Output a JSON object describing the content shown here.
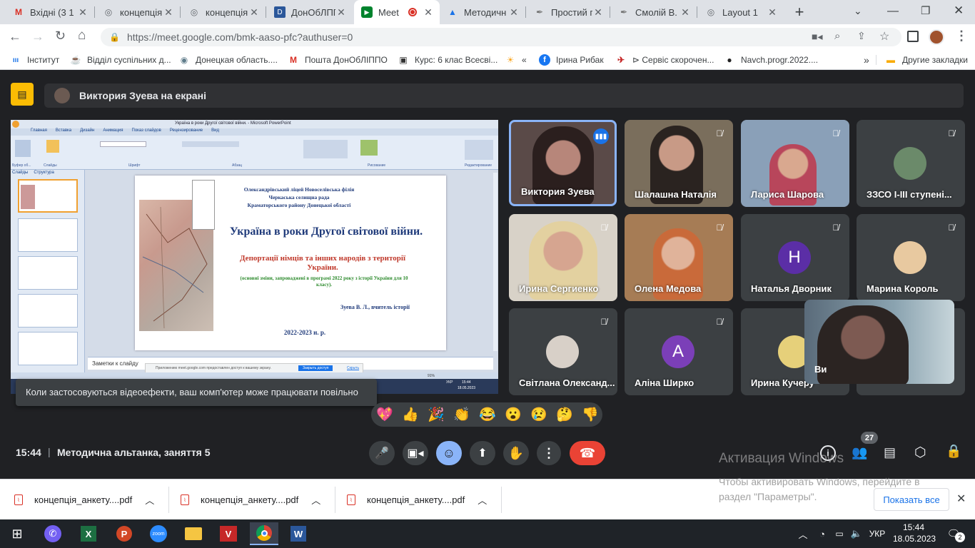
{
  "browser": {
    "tabs": [
      {
        "label": "Вхідні (3 1",
        "icon": "gmail-icon",
        "active": false
      },
      {
        "label": "концепція",
        "icon": "globe-icon",
        "active": false
      },
      {
        "label": "концепція",
        "icon": "globe-icon",
        "active": false
      },
      {
        "label": "ДонОбЛПП",
        "icon": "word-icon",
        "active": false
      },
      {
        "label": "Meet",
        "icon": "meet-icon",
        "active": true
      },
      {
        "label": "Методичн",
        "icon": "drive-icon",
        "active": false
      },
      {
        "label": "Простий г",
        "icon": "quill-icon",
        "active": false
      },
      {
        "label": "Смолій В.",
        "icon": "quill-icon",
        "active": false
      },
      {
        "label": "Layout 1",
        "icon": "globe-icon",
        "active": false
      }
    ],
    "url": "https://meet.google.com/bmk-aaso-pfc?authuser=0",
    "bookmarks": [
      {
        "label": "Інститут",
        "icon": "institute-icon"
      },
      {
        "label": "Відділ суспільних д...",
        "icon": "coffee-icon"
      },
      {
        "label": "Донецкая область....",
        "icon": "eye-icon"
      },
      {
        "label": "Пошта ДонОбЛІППО",
        "icon": "gmail-icon"
      },
      {
        "label": "Курс: 6 клас Всесві...",
        "icon": "course-icon"
      },
      {
        "label": "«",
        "icon": "sun-icon"
      },
      {
        "label": "Ірина Рибак",
        "icon": "facebook-icon"
      },
      {
        "label": "⊳ Сервіс скорочен...",
        "icon": "brand-icon"
      },
      {
        "label": "Navch.progr.2022....",
        "icon": "globe-icon"
      }
    ],
    "more_bookmarks": "»",
    "other_bookmarks": "Другие закладки"
  },
  "meet": {
    "presenter_banner": "Виктория Зуева на екрані",
    "toast": "Коли застосовуються відеоефекти, ваш комп'ютер може працювати повільно",
    "time": "15:44",
    "separator": "|",
    "meeting_title": "Методична альтанка, заняття 5",
    "participants_badge": "27",
    "self_view_label": "Ви",
    "reactions": [
      "💖",
      "👍",
      "🎉",
      "👏",
      "😂",
      "😮",
      "😢",
      "🤔",
      "👎"
    ],
    "participants": [
      {
        "name": "Виктория Зуева",
        "speaking": true
      },
      {
        "name": "Шалашна Наталія"
      },
      {
        "name": "Лариса Шарова"
      },
      {
        "name": "ЗЗСО I-III ступені..."
      },
      {
        "name": "Ирина Сергиенко"
      },
      {
        "name": "Олена Медова"
      },
      {
        "name": "Наталья Дворник",
        "initial": "Н",
        "color": "#5b2ea6"
      },
      {
        "name": "Марина Король"
      },
      {
        "name": "Світлана Олександ..."
      },
      {
        "name": "Аліна Ширко",
        "initial": "A",
        "color": "#7b3fb8"
      },
      {
        "name": "Ирина Кучеру"
      }
    ]
  },
  "slide": {
    "window_title": "Україна в роки Другої світової війни. - Microsoft PowerPoint",
    "ribbon_tabs": [
      "Главная",
      "Вставка",
      "Дизайн",
      "Анимация",
      "Показ слайдов",
      "Рецензирование",
      "Вид"
    ],
    "ribbon_groups": [
      "Буфер об...",
      "Слайды",
      "Шрифт",
      "Абзац",
      "Рисование",
      "Редактирование"
    ],
    "side_tabs": [
      "Слайды",
      "Структура"
    ],
    "header_lines": [
      "Олександрівський ліцей Новоселівська філія",
      "Черкаська селищна рада",
      "Краматорського району Донецької області"
    ],
    "title": "Україна в роки Другої світової війни.",
    "subtitle": "Депортації німців та інших народів з території України.",
    "note": "(основні зміни, запроваджені в програмі 2022 року з історії України для 10 класу).",
    "author": "Зуева В. Л., вчитель історії",
    "year": "2022-2023 н. р.",
    "notes_placeholder": "Заметки к слайду",
    "share_notice": "Приложению meet.google.com предоставлен доступ к вашему экрану.",
    "share_stop": "Закрыть доступ",
    "share_hide": "Скрыть",
    "zoom": "91%",
    "lang": "УКР",
    "tray_time": "15:44",
    "tray_date": "18.05.2023"
  },
  "downloads": {
    "items": [
      "концепція_анкету....pdf",
      "концепція_анкету....pdf",
      "концепція_анкету....pdf"
    ],
    "show_all": "Показать все"
  },
  "watermark": {
    "title": "Активация Windows",
    "line1": "Чтобы активировать Windows, перейдите в",
    "line2": "раздел \"Параметры\"."
  },
  "taskbar": {
    "lang": "УКР",
    "time": "15:44",
    "date": "18.05.2023",
    "notifications": "2"
  }
}
